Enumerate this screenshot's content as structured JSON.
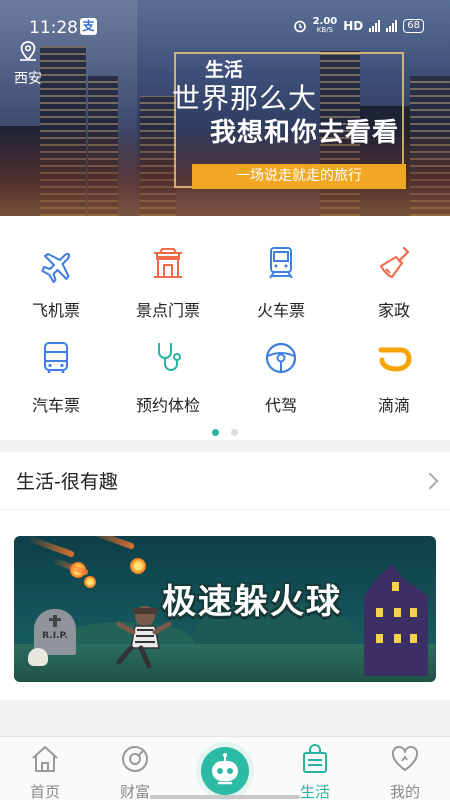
{
  "status_bar": {
    "time": "11:28",
    "app_badge": "支",
    "net_speed_value": "2.00",
    "net_speed_unit": "KB/S",
    "hd": "HD",
    "battery": "68"
  },
  "location": {
    "city": "西安"
  },
  "banner": {
    "small_title": "生活",
    "line1": "世界那么大",
    "line2": "我想和你去看看",
    "tagline": "一场说走就走的旅行"
  },
  "services": [
    {
      "label": "飞机票",
      "icon": "plane-icon",
      "color": "#3f7fe0"
    },
    {
      "label": "景点门票",
      "icon": "gate-icon",
      "color": "#f06a4a"
    },
    {
      "label": "火车票",
      "icon": "train-icon",
      "color": "#3f7fe0"
    },
    {
      "label": "家政",
      "icon": "broom-icon",
      "color": "#f06a4a"
    },
    {
      "label": "汽车票",
      "icon": "bus-icon",
      "color": "#3f7fe0"
    },
    {
      "label": "预约体检",
      "icon": "stethoscope-icon",
      "color": "#27b4a0"
    },
    {
      "label": "代驾",
      "icon": "steering-wheel-icon",
      "color": "#3f7fe0"
    },
    {
      "label": "滴滴",
      "icon": "didi-icon",
      "color": "#f7a400"
    }
  ],
  "pager": {
    "pages": 2,
    "active": 1
  },
  "section": {
    "title": "生活-很有趣",
    "game_banner": {
      "title": "极速躲火球",
      "tomb_text": "R.I.P."
    }
  },
  "bottom_nav": {
    "items": [
      {
        "label": "首页",
        "icon": "home-icon"
      },
      {
        "label": "财富",
        "icon": "wealth-icon"
      },
      {
        "label": "",
        "icon": "robot-assistant-icon"
      },
      {
        "label": "生活",
        "icon": "shopping-bag-icon",
        "active": true
      },
      {
        "label": "我的",
        "icon": "heart-icon"
      }
    ]
  },
  "colors": {
    "accent": "#27b4a0",
    "banner_bar": "#f0a824"
  }
}
